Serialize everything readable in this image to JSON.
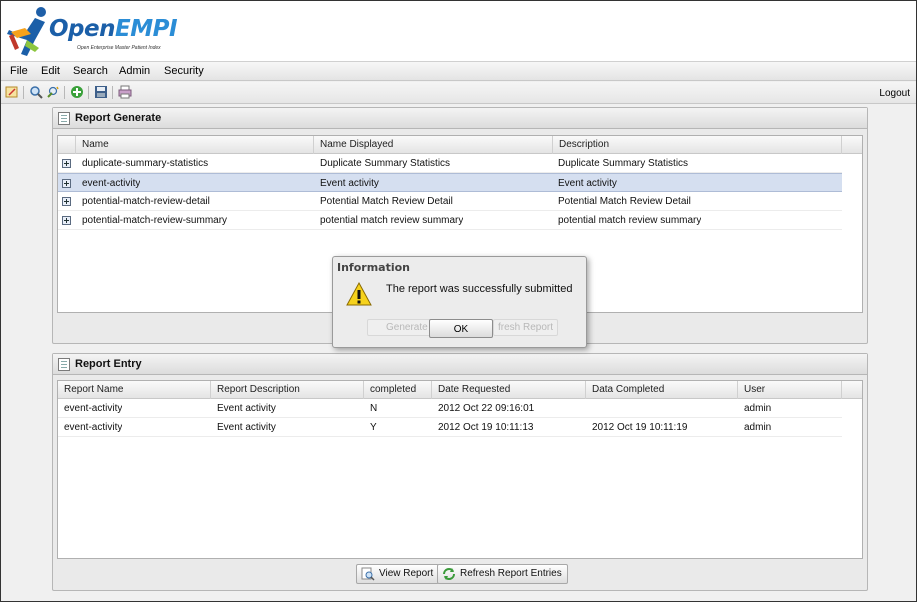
{
  "header": {
    "logo_open": "Open",
    "logo_empi": "EMPI",
    "logo_tagline": "Open Enterprise Master Patient Index"
  },
  "menu": {
    "file": "File",
    "edit": "Edit",
    "search": "Search",
    "admin": "Admin",
    "security": "Security"
  },
  "toolbar": {
    "logout": "Logout",
    "icons": [
      "edit-record-icon",
      "search-icon",
      "advanced-search-icon",
      "add-icon",
      "save-icon",
      "print-icon"
    ]
  },
  "report_generate": {
    "title": "Report Generate",
    "columns": [
      "Name",
      "Name Displayed",
      "Description"
    ],
    "rows": [
      {
        "name": "duplicate-summary-statistics",
        "display": "Duplicate Summary Statistics",
        "description": "Duplicate Summary Statistics"
      },
      {
        "name": "event-activity",
        "display": "Event activity",
        "description": "Event activity"
      },
      {
        "name": "potential-match-review-detail",
        "display": "Potential Match Review Detail",
        "description": "Potential Match Review Detail"
      },
      {
        "name": "potential-match-review-summary",
        "display": "potential match review summary",
        "description": "potential match review summary"
      }
    ],
    "selected_row": 1,
    "generate_label": "Generate",
    "refresh_label_partial": "fresh Report"
  },
  "report_entry": {
    "title": "Report Entry",
    "columns": [
      "Report Name",
      "Report Description",
      "completed",
      "Date Requested",
      "Data Completed",
      "User"
    ],
    "rows": [
      {
        "name": "event-activity",
        "description": "Event activity",
        "completed": "N",
        "requested": "2012 Oct 22 09:16:01",
        "completed_date": "",
        "user": "admin"
      },
      {
        "name": "event-activity",
        "description": "Event activity",
        "completed": "Y",
        "requested": "2012 Oct 19 10:11:13",
        "completed_date": "2012 Oct 19 10:11:19",
        "user": "admin"
      }
    ],
    "view_label": "View Report",
    "refresh_label": "Refresh Report Entries"
  },
  "dialog": {
    "title": "Information",
    "message": "The report was successfully submitted",
    "ok_label": "OK"
  },
  "colors": {
    "selected_row": "#d5dff0",
    "brand_blue": "#1b5fa8",
    "warning_yellow": "#f6d21c"
  }
}
